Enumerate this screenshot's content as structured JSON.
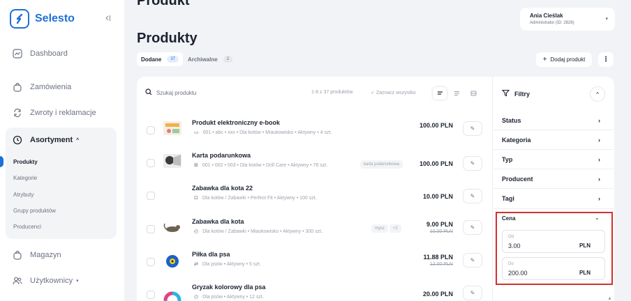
{
  "brand": {
    "name": "Selesto"
  },
  "sidebar": {
    "items": [
      {
        "label": "Dashboard"
      },
      {
        "label": "Zamówienia"
      },
      {
        "label": "Zwroty i reklamacje"
      }
    ],
    "group": {
      "label": "Asortyment",
      "subitems": [
        {
          "label": "Produkty"
        },
        {
          "label": "Kategorie"
        },
        {
          "label": "Atrybuty"
        },
        {
          "label": "Grupy produktów"
        },
        {
          "label": "Producenci"
        }
      ]
    },
    "bottom_items": [
      {
        "label": "Magazyn"
      },
      {
        "label": "Użytkownicy"
      }
    ]
  },
  "header": {
    "top_title": "Produkt",
    "page_title": "Produkty",
    "user": {
      "name": "Ania Cieślak",
      "role": "Administrator (ID: 2826)"
    },
    "tabs": [
      {
        "label": "Dodane",
        "count": "37"
      },
      {
        "label": "Archiwalne",
        "count": "2"
      }
    ],
    "add_label": "Dodaj produkt"
  },
  "toolbar": {
    "search_placeholder": "Szukaj produktu",
    "count_text": "1-8 z 37 produktów",
    "select_all": "Zaznacz wszystko"
  },
  "products": [
    {
      "name": "Produkt elektroniczny e-book",
      "meta": "001 • abc • xxx • Dla kotów • Miaukowisko • Aktywny • 4 szt.",
      "price": "100.00 PLN",
      "old_price": "",
      "tags": []
    },
    {
      "name": "Karta podarunkowa",
      "meta": "001 • 002 • 003 • Dla kotów • Drill Care • Aktywny • 76 szt.",
      "price": "100.00 PLN",
      "old_price": "",
      "tags": [
        "karta podarunkowa"
      ]
    },
    {
      "name": "Zabawka dla kota 22",
      "meta": "Dla kotów / Zabawki • Perfect Fit • Aktywny • 100 szt.",
      "price": "10.00 PLN",
      "old_price": "",
      "tags": []
    },
    {
      "name": "Zabawka dla kota",
      "meta": "Dla kotów / Zabawki • Miaukowisko • Aktywny • 300 szt.",
      "price": "9.00 PLN",
      "old_price": "10.00 PLN",
      "tags": [
        "mysz",
        "+2"
      ]
    },
    {
      "name": "Piłka dla psa",
      "meta": "Dla psów • Aktywny • 5 szt.",
      "price": "11.88 PLN",
      "old_price": "12.00 PLN",
      "tags": []
    },
    {
      "name": "Gryzak kolorowy dla psa",
      "meta": "Dla psów • Aktywny • 12 szt.",
      "price": "20.00 PLN",
      "old_price": "",
      "tags": []
    }
  ],
  "filters": {
    "title": "Filtry",
    "items": [
      {
        "label": "Status"
      },
      {
        "label": "Kategoria"
      },
      {
        "label": "Typ"
      },
      {
        "label": "Producent"
      },
      {
        "label": "Tagi"
      }
    ],
    "price": {
      "label": "Cena",
      "from_label": "Od",
      "from_value": "3.00",
      "to_label": "Do",
      "to_value": "200.00",
      "currency": "PLN"
    }
  },
  "colors": {
    "accent": "#1e6fd9",
    "highlight": "#d32f2f"
  }
}
